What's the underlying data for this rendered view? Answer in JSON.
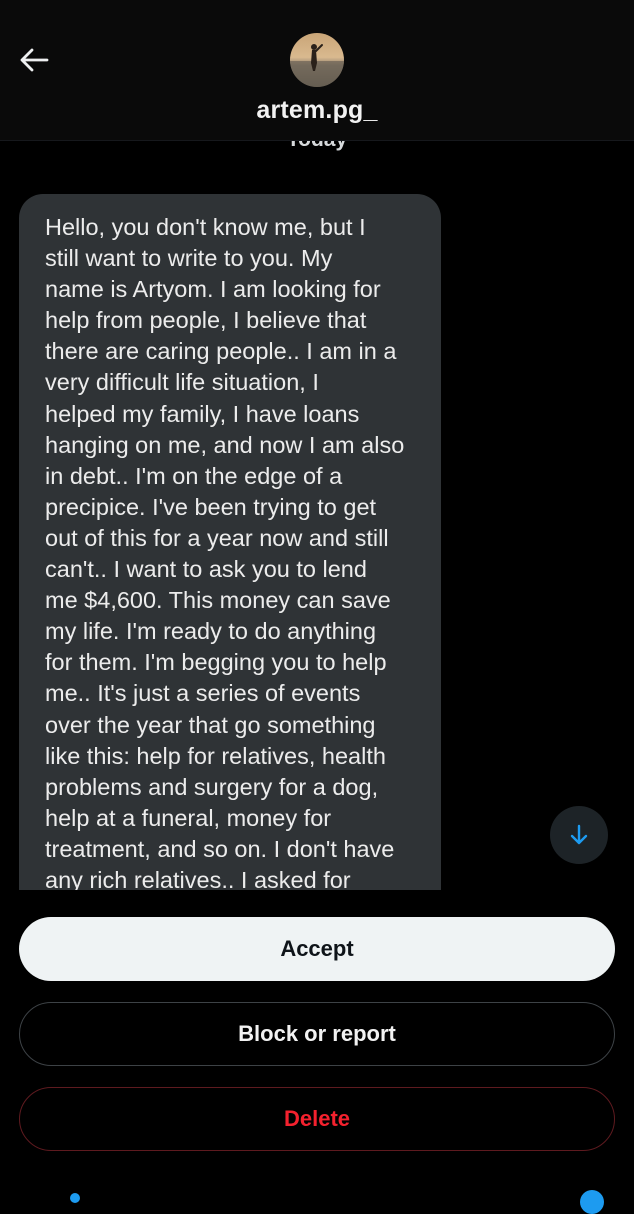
{
  "header": {
    "username": "artem.pg_",
    "back_icon": "arrow-left-icon"
  },
  "chat": {
    "date_label": "Today",
    "message_lines": [
      "Hello, you don't know me, but I",
      "still want to write to you. My",
      "name is Artyom. I am looking for",
      "help from people, I believe that",
      "there are caring people.. I am in a",
      "very difficult life situation, I",
      "helped my family, I have loans",
      "hanging on me, and now I am also",
      "in debt.. I'm on the edge of a",
      "precipice. I've been trying to get",
      "out of this for a year now and still",
      "can't.. I want to ask you to lend",
      "me $4,600. This money can save",
      "my life. I'm ready to do anything",
      "for them. I'm begging you to help",
      "me.. It's just a series of events",
      "over the year that go something",
      "like this: help for relatives, health",
      "problems and surgery for a dog,",
      "help at a funeral, money for",
      "treatment, and so on. I don't have",
      "any rich relatives.. I asked for"
    ],
    "scroll_icon": "arrow-down-icon"
  },
  "actions": {
    "accept_label": "Accept",
    "block_label": "Block or report",
    "delete_label": "Delete"
  },
  "colors": {
    "background": "#000000",
    "bubble": "#2f3336",
    "accent_blue": "#1d9bf0",
    "delete_red": "#f4212e"
  }
}
